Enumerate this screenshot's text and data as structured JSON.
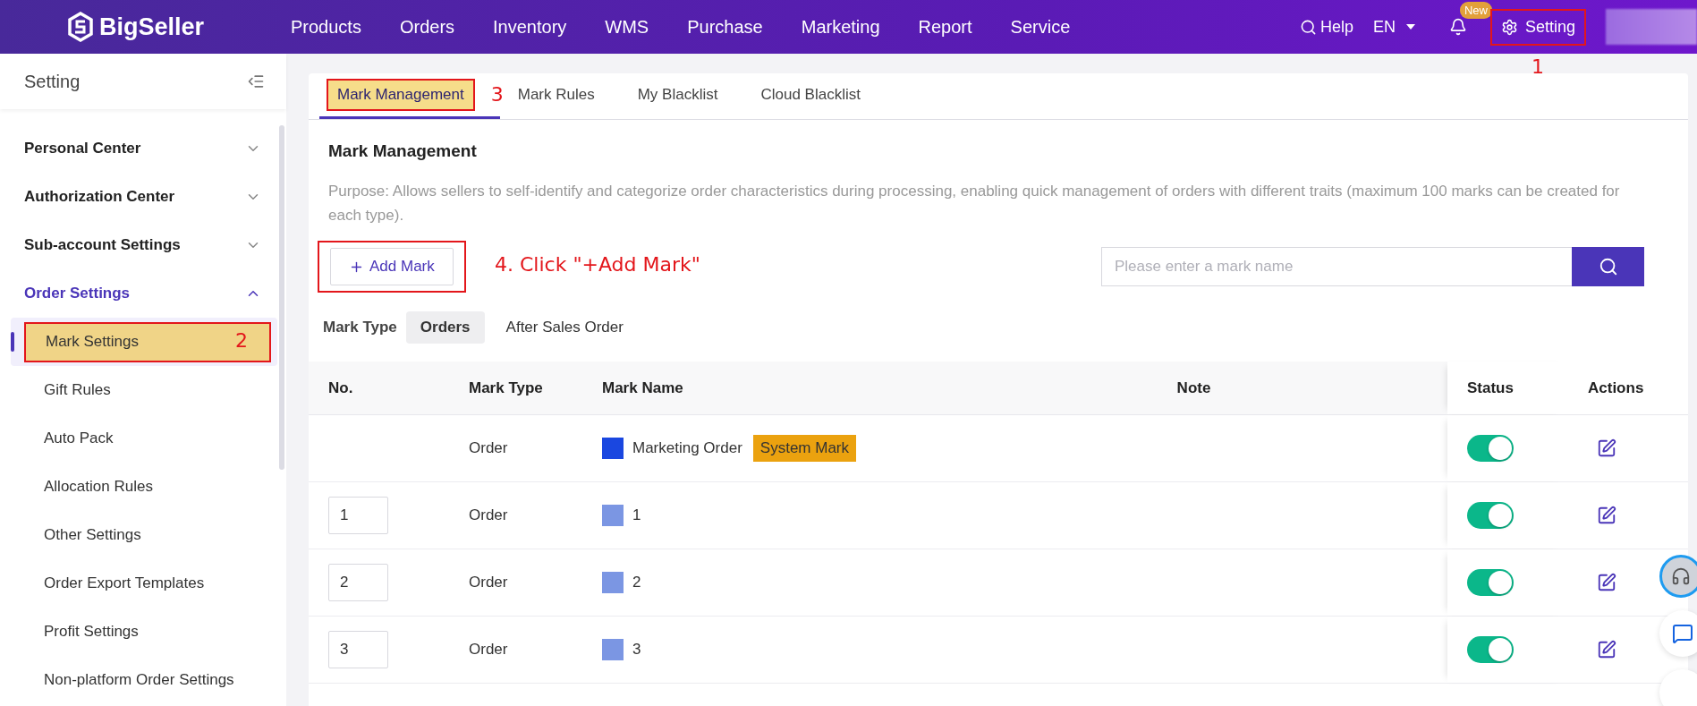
{
  "brand": {
    "name": "BigSeller"
  },
  "nav": [
    {
      "label": "Products"
    },
    {
      "label": "Orders"
    },
    {
      "label": "Inventory"
    },
    {
      "label": "WMS"
    },
    {
      "label": "Purchase"
    },
    {
      "label": "Marketing"
    },
    {
      "label": "Report"
    },
    {
      "label": "Service"
    }
  ],
  "header_tools": {
    "help": "Help",
    "language": "EN",
    "badge": "New",
    "setting": "Setting",
    "setting_highlighted": true
  },
  "sidebar": {
    "title": "Setting",
    "groups": [
      {
        "label": "Personal Center",
        "expanded": false
      },
      {
        "label": "Authorization Center",
        "expanded": false
      },
      {
        "label": "Sub-account Settings",
        "expanded": false
      },
      {
        "label": "Order Settings",
        "expanded": true,
        "items": [
          {
            "label": "Mark Settings",
            "selected": true,
            "highlighted": true
          },
          {
            "label": "Gift Rules",
            "selected": false,
            "highlighted": false
          },
          {
            "label": "Auto Pack",
            "selected": false,
            "highlighted": false
          },
          {
            "label": "Allocation Rules",
            "selected": false,
            "highlighted": false
          },
          {
            "label": "Other Settings",
            "selected": false,
            "highlighted": false
          },
          {
            "label": "Order Export Templates",
            "selected": false,
            "highlighted": false
          },
          {
            "label": "Profit Settings",
            "selected": false,
            "highlighted": false
          },
          {
            "label": "Non-platform Order Settings",
            "selected": false,
            "highlighted": false
          }
        ]
      }
    ]
  },
  "tabs": [
    {
      "label": "Mark Management",
      "selected": true,
      "highlighted": true
    },
    {
      "label": "Mark Rules",
      "selected": false,
      "highlighted": false
    },
    {
      "label": "My Blacklist",
      "selected": false,
      "highlighted": false
    },
    {
      "label": "Cloud Blacklist",
      "selected": false,
      "highlighted": false
    }
  ],
  "section": {
    "title": "Mark Management",
    "purpose": "Purpose: Allows sellers to self-identify and categorize order characteristics during processing, enabling quick management of orders with different traits (maximum 100 marks can be created for each type).",
    "add_button": "Add Mark",
    "add_highlighted": true,
    "search_placeholder": "Please enter a mark name"
  },
  "mark_type": {
    "label": "Mark Type",
    "options": [
      {
        "label": "Orders",
        "selected": true
      },
      {
        "label": "After Sales Order",
        "selected": false
      }
    ]
  },
  "table": {
    "columns": [
      "No.",
      "Mark Type",
      "Mark Name",
      "Note",
      "Status",
      "Actions"
    ],
    "rows": [
      {
        "mark_type": "Order",
        "mark_name": "Marketing Order",
        "color": "#1a47e0",
        "tag": "System Mark",
        "on": true
      },
      {
        "no": "1",
        "mark_type": "Order",
        "mark_name": "1",
        "color": "#7b96e3",
        "on": true
      },
      {
        "no": "2",
        "mark_type": "Order",
        "mark_name": "2",
        "color": "#7b96e3",
        "on": true
      },
      {
        "no": "3",
        "mark_type": "Order",
        "mark_name": "3",
        "color": "#7b96e3",
        "on": true
      }
    ]
  },
  "annotations": {
    "step_1": "1",
    "step_2": "2",
    "step_3": "3",
    "step_4": "4. Click \"+Add Mark\""
  }
}
